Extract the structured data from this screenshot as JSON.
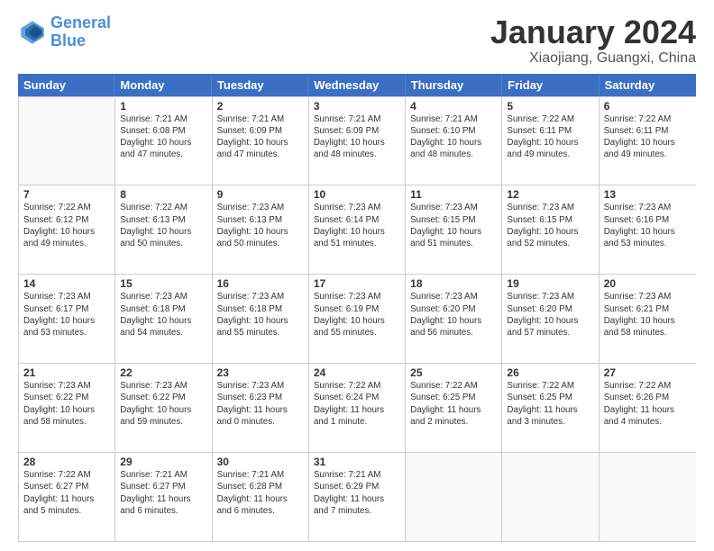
{
  "logo": {
    "line1": "General",
    "line2": "Blue"
  },
  "title": "January 2024",
  "subtitle": "Xiaojiang, Guangxi, China",
  "header": {
    "days": [
      "Sunday",
      "Monday",
      "Tuesday",
      "Wednesday",
      "Thursday",
      "Friday",
      "Saturday"
    ]
  },
  "weeks": [
    [
      {
        "day": "",
        "info": ""
      },
      {
        "day": "1",
        "info": "Sunrise: 7:21 AM\nSunset: 6:08 PM\nDaylight: 10 hours\nand 47 minutes."
      },
      {
        "day": "2",
        "info": "Sunrise: 7:21 AM\nSunset: 6:09 PM\nDaylight: 10 hours\nand 47 minutes."
      },
      {
        "day": "3",
        "info": "Sunrise: 7:21 AM\nSunset: 6:09 PM\nDaylight: 10 hours\nand 48 minutes."
      },
      {
        "day": "4",
        "info": "Sunrise: 7:21 AM\nSunset: 6:10 PM\nDaylight: 10 hours\nand 48 minutes."
      },
      {
        "day": "5",
        "info": "Sunrise: 7:22 AM\nSunset: 6:11 PM\nDaylight: 10 hours\nand 49 minutes."
      },
      {
        "day": "6",
        "info": "Sunrise: 7:22 AM\nSunset: 6:11 PM\nDaylight: 10 hours\nand 49 minutes."
      }
    ],
    [
      {
        "day": "7",
        "info": "Sunrise: 7:22 AM\nSunset: 6:12 PM\nDaylight: 10 hours\nand 49 minutes."
      },
      {
        "day": "8",
        "info": "Sunrise: 7:22 AM\nSunset: 6:13 PM\nDaylight: 10 hours\nand 50 minutes."
      },
      {
        "day": "9",
        "info": "Sunrise: 7:23 AM\nSunset: 6:13 PM\nDaylight: 10 hours\nand 50 minutes."
      },
      {
        "day": "10",
        "info": "Sunrise: 7:23 AM\nSunset: 6:14 PM\nDaylight: 10 hours\nand 51 minutes."
      },
      {
        "day": "11",
        "info": "Sunrise: 7:23 AM\nSunset: 6:15 PM\nDaylight: 10 hours\nand 51 minutes."
      },
      {
        "day": "12",
        "info": "Sunrise: 7:23 AM\nSunset: 6:15 PM\nDaylight: 10 hours\nand 52 minutes."
      },
      {
        "day": "13",
        "info": "Sunrise: 7:23 AM\nSunset: 6:16 PM\nDaylight: 10 hours\nand 53 minutes."
      }
    ],
    [
      {
        "day": "14",
        "info": "Sunrise: 7:23 AM\nSunset: 6:17 PM\nDaylight: 10 hours\nand 53 minutes."
      },
      {
        "day": "15",
        "info": "Sunrise: 7:23 AM\nSunset: 6:18 PM\nDaylight: 10 hours\nand 54 minutes."
      },
      {
        "day": "16",
        "info": "Sunrise: 7:23 AM\nSunset: 6:18 PM\nDaylight: 10 hours\nand 55 minutes."
      },
      {
        "day": "17",
        "info": "Sunrise: 7:23 AM\nSunset: 6:19 PM\nDaylight: 10 hours\nand 55 minutes."
      },
      {
        "day": "18",
        "info": "Sunrise: 7:23 AM\nSunset: 6:20 PM\nDaylight: 10 hours\nand 56 minutes."
      },
      {
        "day": "19",
        "info": "Sunrise: 7:23 AM\nSunset: 6:20 PM\nDaylight: 10 hours\nand 57 minutes."
      },
      {
        "day": "20",
        "info": "Sunrise: 7:23 AM\nSunset: 6:21 PM\nDaylight: 10 hours\nand 58 minutes."
      }
    ],
    [
      {
        "day": "21",
        "info": "Sunrise: 7:23 AM\nSunset: 6:22 PM\nDaylight: 10 hours\nand 58 minutes."
      },
      {
        "day": "22",
        "info": "Sunrise: 7:23 AM\nSunset: 6:22 PM\nDaylight: 10 hours\nand 59 minutes."
      },
      {
        "day": "23",
        "info": "Sunrise: 7:23 AM\nSunset: 6:23 PM\nDaylight: 11 hours\nand 0 minutes."
      },
      {
        "day": "24",
        "info": "Sunrise: 7:22 AM\nSunset: 6:24 PM\nDaylight: 11 hours\nand 1 minute."
      },
      {
        "day": "25",
        "info": "Sunrise: 7:22 AM\nSunset: 6:25 PM\nDaylight: 11 hours\nand 2 minutes."
      },
      {
        "day": "26",
        "info": "Sunrise: 7:22 AM\nSunset: 6:25 PM\nDaylight: 11 hours\nand 3 minutes."
      },
      {
        "day": "27",
        "info": "Sunrise: 7:22 AM\nSunset: 6:26 PM\nDaylight: 11 hours\nand 4 minutes."
      }
    ],
    [
      {
        "day": "28",
        "info": "Sunrise: 7:22 AM\nSunset: 6:27 PM\nDaylight: 11 hours\nand 5 minutes."
      },
      {
        "day": "29",
        "info": "Sunrise: 7:21 AM\nSunset: 6:27 PM\nDaylight: 11 hours\nand 6 minutes."
      },
      {
        "day": "30",
        "info": "Sunrise: 7:21 AM\nSunset: 6:28 PM\nDaylight: 11 hours\nand 6 minutes."
      },
      {
        "day": "31",
        "info": "Sunrise: 7:21 AM\nSunset: 6:29 PM\nDaylight: 11 hours\nand 7 minutes."
      },
      {
        "day": "",
        "info": ""
      },
      {
        "day": "",
        "info": ""
      },
      {
        "day": "",
        "info": ""
      }
    ]
  ]
}
